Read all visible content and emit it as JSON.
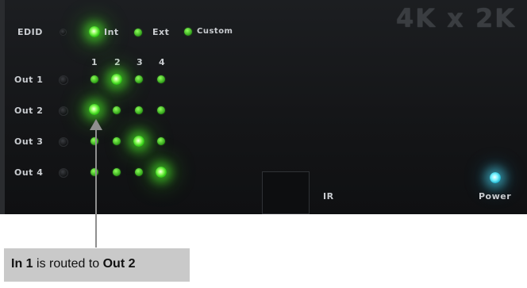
{
  "header": {
    "title": "4K x 2K"
  },
  "edid": {
    "label": "EDID",
    "options": [
      {
        "label": "Int"
      },
      {
        "label": "Ext"
      },
      {
        "label": "Custom"
      }
    ]
  },
  "matrix": {
    "inputs": [
      "1",
      "2",
      "3",
      "4"
    ],
    "outputs": [
      {
        "label": "Out 1",
        "active_input": 2
      },
      {
        "label": "Out 2",
        "active_input": 1
      },
      {
        "label": "Out 3",
        "active_input": 3
      },
      {
        "label": "Out 4",
        "active_input": 4
      }
    ]
  },
  "ir": {
    "label": "IR"
  },
  "power": {
    "label": "Power"
  },
  "callout": {
    "part1": "In 1",
    "part2": " is routed to ",
    "part3": "Out 2"
  },
  "colors": {
    "led_green": "#39d41a",
    "power_cyan": "#7ff4ff",
    "callout_bg": "#c9c9c9"
  }
}
